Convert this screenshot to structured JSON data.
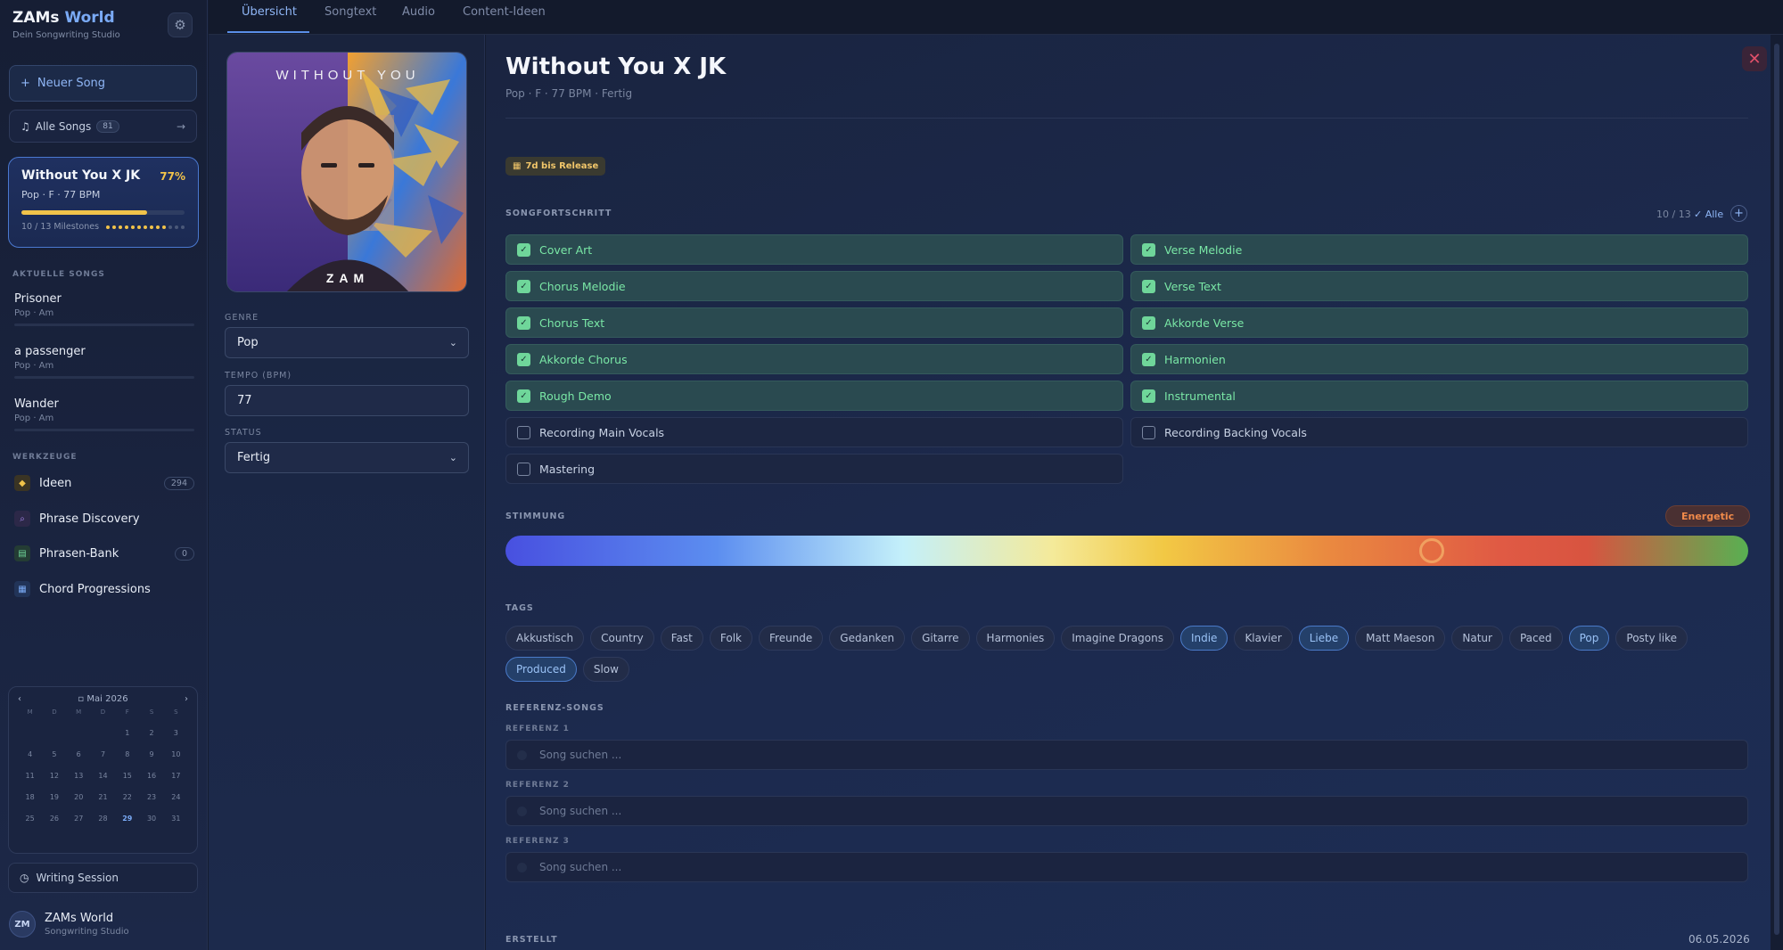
{
  "brand": {
    "name": "ZAMs",
    "name_accent": "World",
    "subtitle": "Dein Songwriting Studio"
  },
  "sidebar": {
    "new_song": "Neuer Song",
    "all_songs": {
      "label": "Alle Songs",
      "count": "81"
    },
    "active_song": {
      "title": "Without You X JK",
      "percent": "77%",
      "meta": "Pop · F · 77 BPM",
      "progress": 0.77,
      "milestones": "10 / 13 Milestones",
      "milestones_done": 10,
      "milestones_total": 13
    },
    "recent_label": "AKTUELLE SONGS",
    "recent": [
      {
        "title": "Prisoner",
        "meta": "Pop · Am"
      },
      {
        "title": "a passenger",
        "meta": "Pop · Am"
      },
      {
        "title": "Wander",
        "meta": "Pop · Am"
      }
    ],
    "tools_label": "WERKZEUGE",
    "tools": [
      {
        "label": "Ideen",
        "count": "294",
        "icon": "lightbulb-icon"
      },
      {
        "label": "Phrase Discovery",
        "count": "",
        "icon": "magnifier-icon"
      },
      {
        "label": "Phrasen-Bank",
        "count": "0",
        "icon": "book-icon"
      },
      {
        "label": "Chord Progressions",
        "count": "",
        "icon": "keyboard-icon"
      }
    ],
    "calendar": {
      "month": "Mai 2026",
      "weekdays": [
        "M",
        "D",
        "M",
        "D",
        "F",
        "S",
        "S"
      ],
      "days": [
        "",
        "",
        "",
        "",
        "1",
        "2",
        "3",
        "4",
        "5",
        "6",
        "7",
        "8",
        "9",
        "10",
        "11",
        "12",
        "13",
        "14",
        "15",
        "16",
        "17",
        "18",
        "19",
        "20",
        "21",
        "22",
        "23",
        "24",
        "25",
        "26",
        "27",
        "28",
        "29",
        "30",
        "31"
      ],
      "today": "29"
    },
    "writing_session": "Writing Session",
    "user": {
      "initials": "ZM",
      "name": "ZAMs World",
      "sub": "Songwriting Studio"
    }
  },
  "tabs": [
    "Übersicht",
    "Songtext",
    "Audio",
    "Content-Ideen"
  ],
  "active_tab": "Übersicht",
  "left_panel": {
    "cover": {
      "title": "WITHOUT YOU",
      "artist": "ZAM"
    },
    "genre_label": "GENRE",
    "genre": "Pop",
    "tempo_label": "TEMPO (BPM)",
    "tempo": "77",
    "status_label": "STATUS",
    "status": "Fertig"
  },
  "main": {
    "title": "Without You X JK",
    "subtitle": "Pop · F · 77 BPM · Fertig",
    "release_badge": "7d bis Release",
    "milestones_label": "SONGFORTSCHRITT",
    "milestones_count": "10 / 13",
    "milestones_all": "✓ Alle",
    "milestones": [
      {
        "label": "Cover Art",
        "done": true
      },
      {
        "label": "Verse Melodie",
        "done": true
      },
      {
        "label": "Chorus Melodie",
        "done": true
      },
      {
        "label": "Verse Text",
        "done": true
      },
      {
        "label": "Chorus Text",
        "done": true
      },
      {
        "label": "Akkorde Verse",
        "done": true
      },
      {
        "label": "Akkorde Chorus",
        "done": true
      },
      {
        "label": "Harmonien",
        "done": true
      },
      {
        "label": "Rough Demo",
        "done": true
      },
      {
        "label": "Instrumental",
        "done": true
      },
      {
        "label": "Recording Main Vocals",
        "done": false
      },
      {
        "label": "Recording Backing Vocals",
        "done": false
      },
      {
        "label": "Mastering",
        "done": false
      }
    ],
    "mood_label": "STIMMUNG",
    "mood_value": "Energetic",
    "mood_position": 0.745,
    "tags_label": "TAGS",
    "tags": [
      {
        "label": "Akkustisch",
        "selected": false
      },
      {
        "label": "Country",
        "selected": false
      },
      {
        "label": "Fast",
        "selected": false
      },
      {
        "label": "Folk",
        "selected": false
      },
      {
        "label": "Freunde",
        "selected": false
      },
      {
        "label": "Gedanken",
        "selected": false
      },
      {
        "label": "Gitarre",
        "selected": false
      },
      {
        "label": "Harmonies",
        "selected": false
      },
      {
        "label": "Imagine Dragons",
        "selected": false
      },
      {
        "label": "Indie",
        "selected": true
      },
      {
        "label": "Klavier",
        "selected": false
      },
      {
        "label": "Liebe",
        "selected": true
      },
      {
        "label": "Matt Maeson",
        "selected": false
      },
      {
        "label": "Natur",
        "selected": false
      },
      {
        "label": "Paced",
        "selected": false
      },
      {
        "label": "Pop",
        "selected": true
      },
      {
        "label": "Posty like",
        "selected": false
      },
      {
        "label": "Produced",
        "selected": true
      },
      {
        "label": "Slow",
        "selected": false
      }
    ],
    "references_label": "REFERENZ-SONGS",
    "references": [
      {
        "label": "REFERENZ 1",
        "placeholder": "Song suchen ..."
      },
      {
        "label": "REFERENZ 2",
        "placeholder": "Song suchen ..."
      },
      {
        "label": "REFERENZ 3",
        "placeholder": "Song suchen ..."
      }
    ],
    "created_label": "ERSTELLT",
    "created_date": "06.05.2026"
  }
}
